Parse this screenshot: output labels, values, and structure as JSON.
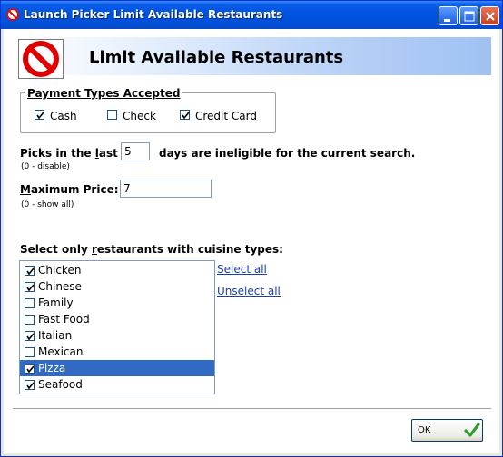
{
  "window": {
    "title": "Launch Picker Limit Available Restaurants"
  },
  "banner": {
    "title": "Limit Available Restaurants",
    "icon": "no-entry-icon"
  },
  "payment": {
    "legend": "Payment Types Accepted",
    "options": [
      {
        "label": "Cash",
        "checked": true
      },
      {
        "label": "Check",
        "checked": false
      },
      {
        "label": "Credit Card",
        "checked": true
      }
    ]
  },
  "picks": {
    "label_prefix": "Picks in the ",
    "label_underlined": "l",
    "label_suffix": "ast",
    "value": "5",
    "after": "days are ineligible for the current search.",
    "hint": "(0 - disable)"
  },
  "price": {
    "label_underlined": "M",
    "label_rest": "aximum Price:",
    "value": "7",
    "hint": "(0 - show all)"
  },
  "cuisine": {
    "label_prefix": "Select only ",
    "label_underlined": "r",
    "label_suffix": "estaurants with cuisine types:",
    "items": [
      {
        "label": "Chicken",
        "checked": true,
        "selected": false
      },
      {
        "label": "Chinese",
        "checked": true,
        "selected": false
      },
      {
        "label": "Family",
        "checked": false,
        "selected": false
      },
      {
        "label": "Fast Food",
        "checked": false,
        "selected": false
      },
      {
        "label": "Italian",
        "checked": true,
        "selected": false
      },
      {
        "label": "Mexican",
        "checked": false,
        "selected": false
      },
      {
        "label": "Pizza",
        "checked": true,
        "selected": true
      },
      {
        "label": "Seafood",
        "checked": true,
        "selected": false
      }
    ],
    "select_all": "Select all",
    "unselect_all": "Unselect all"
  },
  "footer": {
    "ok_label": "OK",
    "ok_icon": "green-checkmark-icon"
  },
  "colors": {
    "titlebar": "#0054e3",
    "selection": "#316ac5",
    "link": "#1a3fa8"
  }
}
